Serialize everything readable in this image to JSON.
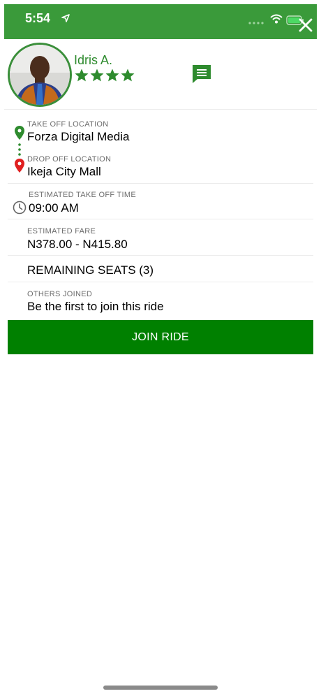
{
  "status_bar": {
    "time": "5:54"
  },
  "driver": {
    "name": "Idris A.",
    "rating": 4,
    "rating_max": 4
  },
  "trip": {
    "takeoff_label": "TAKE OFF LOCATION",
    "takeoff_value": "Forza Digital Media",
    "dropoff_label": "DROP OFF LOCATION",
    "dropoff_value": "Ikeja City Mall",
    "time_label": "ESTIMATED TAKE OFF TIME",
    "time_value": "09:00 AM",
    "fare_label": "ESTIMATED FARE",
    "fare_value": "N378.00 - N415.80",
    "seats_value": "REMAINING SEATS (3)",
    "joined_label": "OTHERS JOINED",
    "joined_value": "Be the first to join this ride"
  },
  "actions": {
    "join_label": "JOIN RIDE"
  },
  "icons": {
    "close": "close-icon",
    "message": "message-icon",
    "takeoff": "location-pin-icon",
    "dropoff": "location-pin-icon",
    "clock": "clock-icon",
    "star": "star-icon"
  },
  "colors": {
    "header": "#3a9a3a",
    "brand_green": "#008000",
    "dropoff_pin": "#e02020"
  }
}
